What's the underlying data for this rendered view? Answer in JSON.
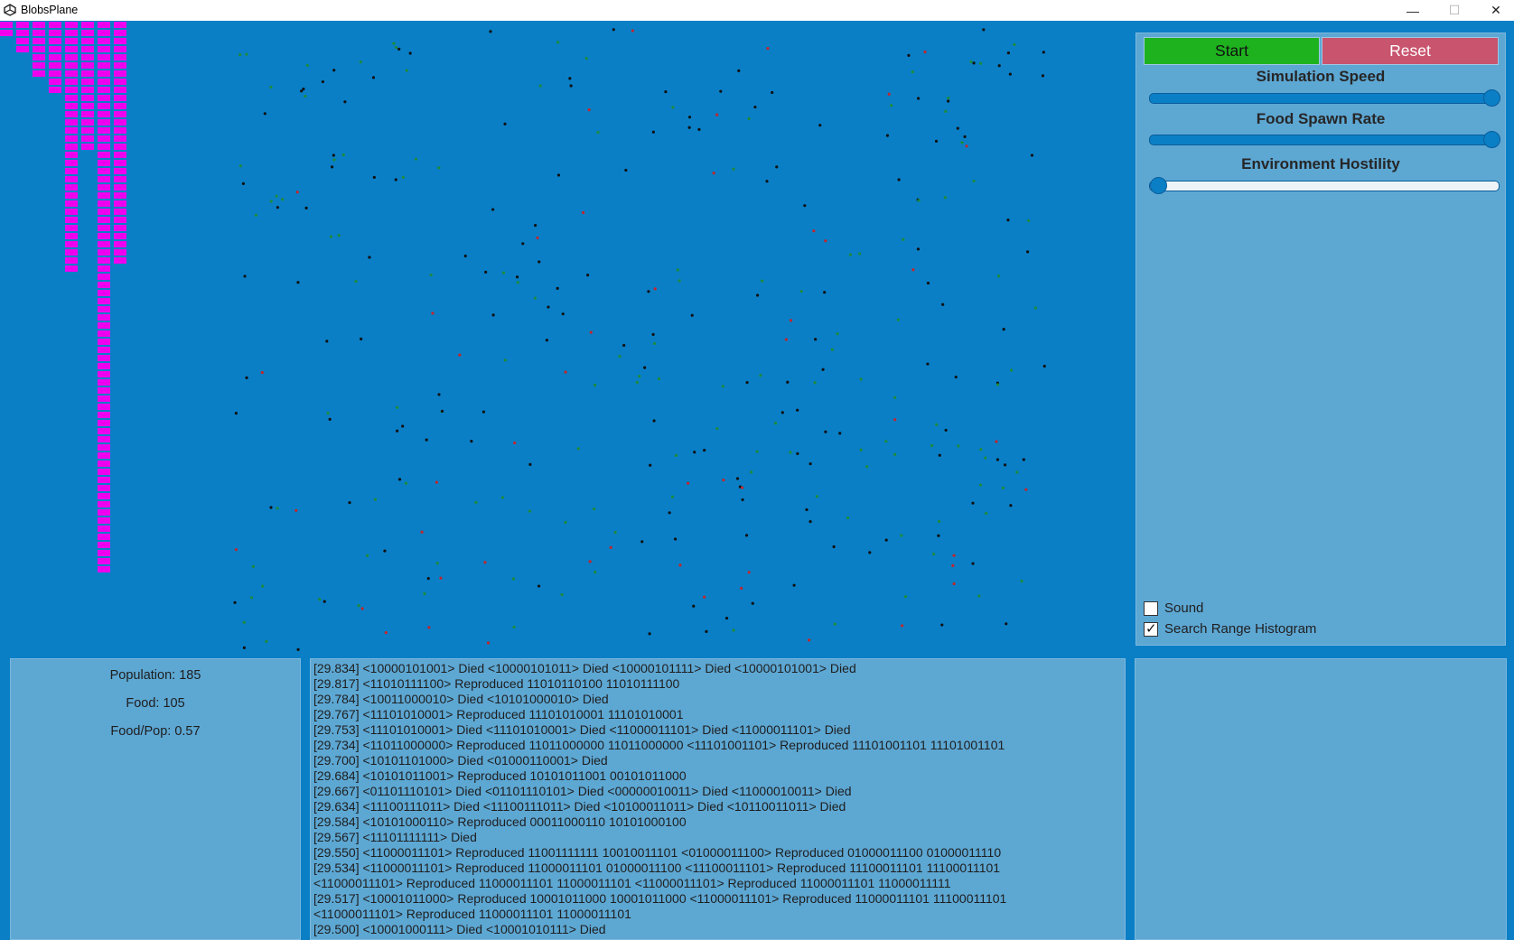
{
  "window": {
    "title": "BlobsPlane",
    "minimize_glyph": "—",
    "maximize_glyph": "☐",
    "close_glyph": "✕"
  },
  "controls": {
    "start_label": "Start",
    "reset_label": "Reset",
    "sliders": [
      {
        "label": "Simulation Speed",
        "value": 1.0
      },
      {
        "label": "Food Spawn Rate",
        "value": 1.0
      },
      {
        "label": "Environment Hostility",
        "value": 0.0
      }
    ],
    "checkboxes": [
      {
        "label": "Sound",
        "checked": false
      },
      {
        "label": "Search Range Histogram",
        "checked": true
      }
    ]
  },
  "stats": {
    "population": "Population: 185",
    "food": "Food: 105",
    "food_per_pop": "Food/Pop: 0.57"
  },
  "log": [
    "[29.834] <10000101001> Died <10000101011> Died <10000101111> Died <10000101001> Died",
    "[29.817] <11010111100> Reproduced 11010110100 11010111100",
    "[29.784] <10011000010> Died <10101000010> Died",
    "[29.767] <11101010001> Reproduced 11101010001 11101010001",
    "[29.753] <11101010001> Died <11101010001> Died <11000011101> Died <11000011101> Died",
    "[29.734] <11011000000> Reproduced 11011000000 11011000000 <11101001101> Reproduced 11101001101 11101001101",
    "[29.700] <10101101000> Died <01000110001> Died",
    "[29.684] <10101011001> Reproduced 10101011001 00101011000",
    "[29.667] <01101110101> Died <01101110101> Died <00000010011> Died <11000010011> Died",
    "[29.634] <11100111011> Died <11100111011> Died <10100011011> Died <10110011011> Died",
    "[29.584] <10101000110> Reproduced 00011000110 10101000100",
    "[29.567] <11101111111> Died",
    "[29.550] <11000011101> Reproduced 11001111111 10010011101 <01000011100> Reproduced 01000011100 01000011110",
    "[29.534] <11000011101> Reproduced 11000011101 01000011100 <11100011101> Reproduced 11100011101 11100011101",
    "<11000011101> Reproduced 11000011101 11000011101 <11000011101> Reproduced 11000011101 11000011111",
    "[29.517] <10001011000> Reproduced 10001011000 10001011000 <11000011101> Reproduced 11000011101 11100011101",
    "<11000011101> Reproduced 11000011101 11000011101",
    "[29.500] <10001000111> Died <10001010111> Died"
  ],
  "histogram": {
    "color": "#ee00ee",
    "bar_counts": [
      2,
      4,
      7,
      9,
      31,
      16,
      68,
      30
    ]
  },
  "colors": {
    "background": "#0a7fc6",
    "panel": "#5da7d3",
    "start": "#1fb21f",
    "reset": "#c8546e",
    "blob": "#111111",
    "food": "#1d8a3a",
    "hostile": "#c0262b"
  }
}
